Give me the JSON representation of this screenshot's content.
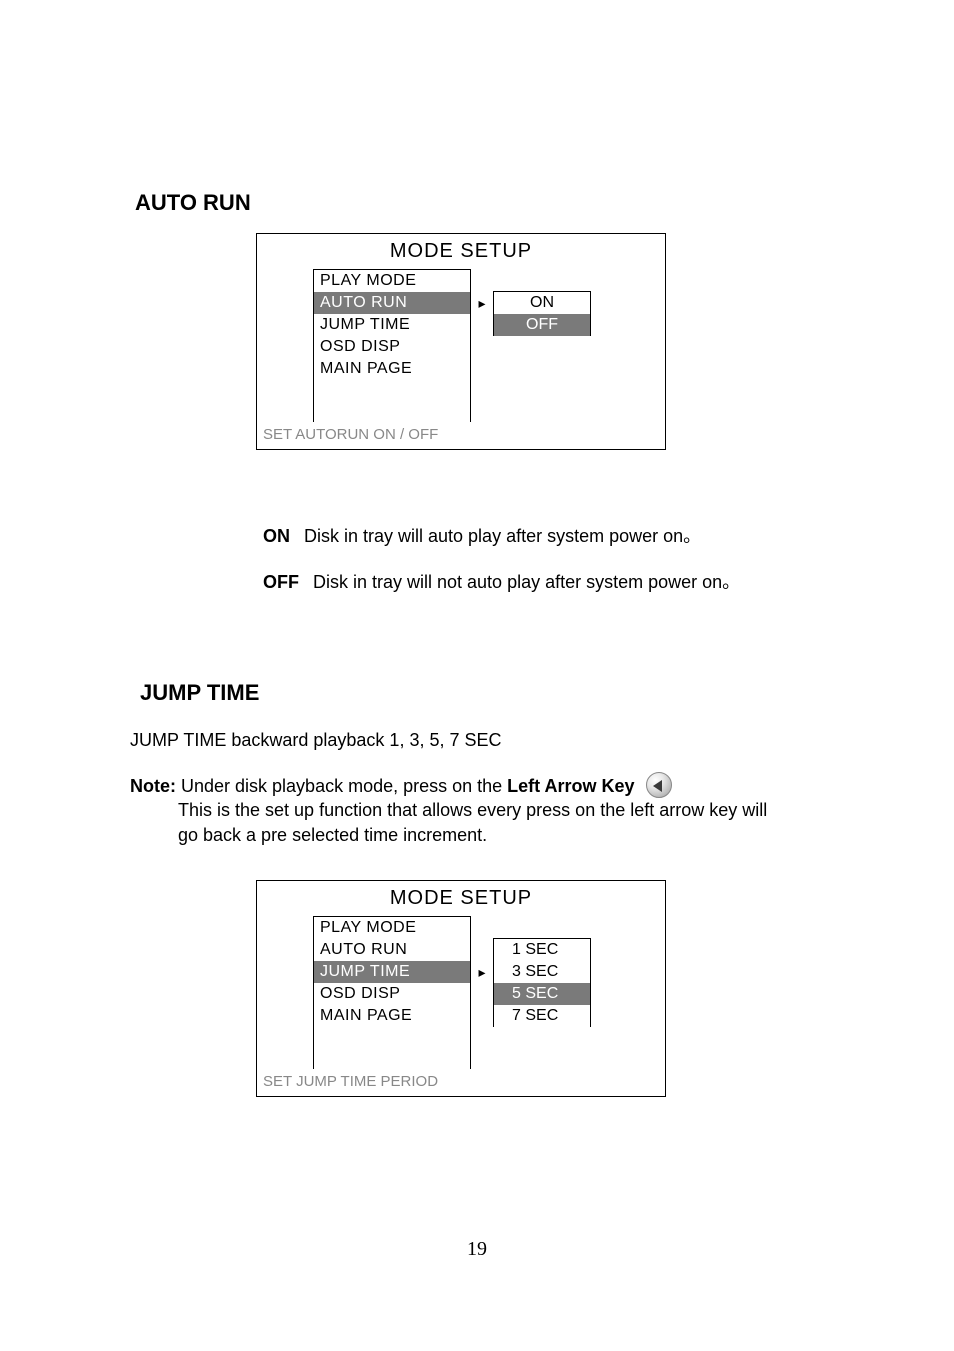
{
  "sections": {
    "autoRunTitle": "AUTO RUN",
    "jumpTimeTitle": "JUMP TIME"
  },
  "modeSetup1": {
    "title": "MODE SETUP",
    "left": {
      "playMode": "PLAY MODE",
      "autoRun": "AUTO RUN",
      "jumpTime": "JUMP TIME",
      "osdDisp": "OSD DISP",
      "mainPage": "MAIN PAGE"
    },
    "right": {
      "on": "ON",
      "off": "OFF"
    },
    "footer": "SET AUTORUN ON / OFF",
    "arrow": "▸"
  },
  "defs": {
    "on": {
      "key": "ON",
      "val": "Disk in tray will auto play after system power on。"
    },
    "off": {
      "key": "OFF",
      "val": "Disk in tray will not  auto play after system power on。"
    }
  },
  "jumpTime": {
    "line": "JUMP TIME backward playback 1, 3, 5, 7 SEC",
    "noteLabel": "Note:",
    "noteLine1a": " Under disk playback mode, press on the ",
    "noteLine1bBold": "Left Arrow Key",
    "noteLine2": "This is the set up function that allows every press on the left arrow key will",
    "noteLine3": "go back a pre selected time increment."
  },
  "modeSetup2": {
    "title": "MODE SETUP",
    "left": {
      "playMode": "PLAY MODE",
      "autoRun": "AUTO RUN",
      "jumpTime": "JUMP TIME",
      "osdDisp": "OSD DISP",
      "mainPage": "MAIN PAGE"
    },
    "right": {
      "s1": "1 SEC",
      "s3": "3 SEC",
      "s5": "5 SEC",
      "s7": "7 SEC"
    },
    "footer": "SET JUMP TIME PERIOD",
    "arrow": "▸"
  },
  "pageNumber": "19"
}
